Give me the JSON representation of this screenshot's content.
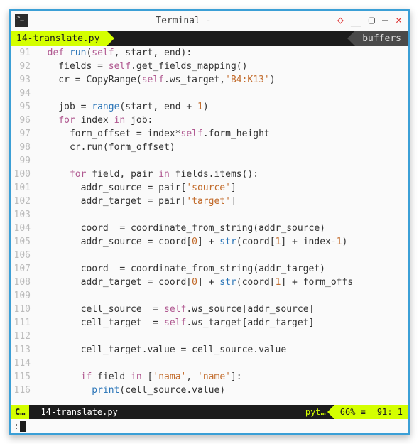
{
  "window": {
    "title": "Terminal -"
  },
  "tabs": {
    "active": "14-translate.py",
    "right": "buffers"
  },
  "code_lines": [
    {
      "n": "91",
      "html": "  <span class='kw'>def</span> <span class='fn'>run</span>(<span class='kw2'>self</span>, start, end):"
    },
    {
      "n": "92",
      "html": "    fields = <span class='kw2'>self</span>.get_fields_mapping()"
    },
    {
      "n": "93",
      "html": "    cr = CopyRange(<span class='kw2'>self</span>.ws_target,<span class='str'>'B4:K13'</span>)"
    },
    {
      "n": "94",
      "html": ""
    },
    {
      "n": "95",
      "html": "    job = <span class='builtin'>range</span>(start, end + <span class='num'>1</span>)"
    },
    {
      "n": "96",
      "html": "    <span class='kw'>for</span> index <span class='kw'>in</span> job:"
    },
    {
      "n": "97",
      "html": "      form_offset = index*<span class='kw2'>self</span>.form_height"
    },
    {
      "n": "98",
      "html": "      cr.run(form_offset)"
    },
    {
      "n": "99",
      "html": ""
    },
    {
      "n": "100",
      "html": "      <span class='kw'>for</span> field, pair <span class='kw'>in</span> fields.items():"
    },
    {
      "n": "101",
      "html": "        addr_source = pair[<span class='str'>'source'</span>]"
    },
    {
      "n": "102",
      "html": "        addr_target = pair[<span class='str'>'target'</span>]"
    },
    {
      "n": "103",
      "html": ""
    },
    {
      "n": "104",
      "html": "        coord  = coordinate_from_string(addr_source)"
    },
    {
      "n": "105",
      "html": "        addr_source = coord[<span class='num'>0</span>] + <span class='builtin'>str</span>(coord[<span class='num'>1</span>] + index-<span class='num'>1</span>)"
    },
    {
      "n": "106",
      "html": ""
    },
    {
      "n": "107",
      "html": "        coord  = coordinate_from_string(addr_target)"
    },
    {
      "n": "108",
      "html": "        addr_target = coord[<span class='num'>0</span>] + <span class='builtin'>str</span>(coord[<span class='num'>1</span>] + form_offs"
    },
    {
      "n": "109",
      "html": ""
    },
    {
      "n": "110",
      "html": "        cell_source  = <span class='kw2'>self</span>.ws_source[addr_source]"
    },
    {
      "n": "111",
      "html": "        cell_target  = <span class='kw2'>self</span>.ws_target[addr_target]"
    },
    {
      "n": "112",
      "html": ""
    },
    {
      "n": "113",
      "html": "        cell_target.value = cell_source.value"
    },
    {
      "n": "114",
      "html": ""
    },
    {
      "n": "115",
      "html": "        <span class='kw'>if</span> field <span class='kw'>in</span> [<span class='str'>'nama'</span>, <span class='str'>'name'</span>]:"
    },
    {
      "n": "116",
      "html": "          <span class='builtin'>print</span>(cell_source.value)"
    }
  ],
  "status": {
    "mode": "C…",
    "file": "14-translate.py",
    "filetype": "pyt…",
    "percent": "66% ≡",
    "ruler": "91:  1"
  },
  "cmdline": {
    "prompt": ":"
  }
}
